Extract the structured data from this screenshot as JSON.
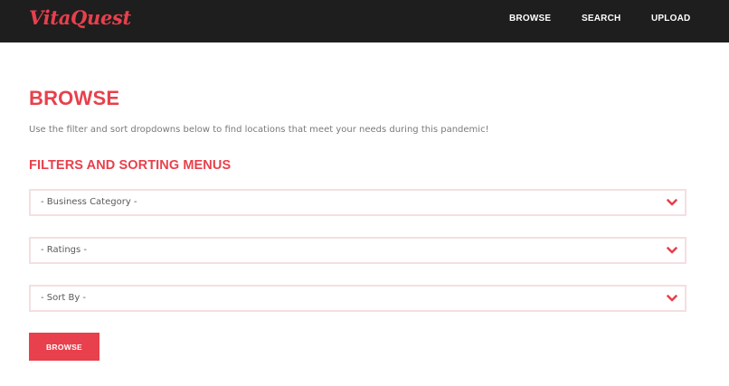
{
  "brand": {
    "logo_text": "VitaQuest",
    "accent_color": "#e8404c"
  },
  "nav": {
    "items": [
      {
        "label": "BROWSE"
      },
      {
        "label": "SEARCH"
      },
      {
        "label": "UPLOAD"
      }
    ]
  },
  "main": {
    "title": "BROWSE",
    "intro": "Use the filter and sort dropdowns below to find locations that meet your needs during this pandemic!",
    "section_title": "FILTERS AND SORTING MENUS",
    "filters": [
      {
        "selected": "- Business Category -",
        "icon": "chevron-down-icon"
      },
      {
        "selected": "- Ratings -",
        "icon": "chevron-down-icon"
      },
      {
        "selected": "- Sort By -",
        "icon": "chevron-down-icon"
      }
    ],
    "submit_label": "BROWSE"
  }
}
